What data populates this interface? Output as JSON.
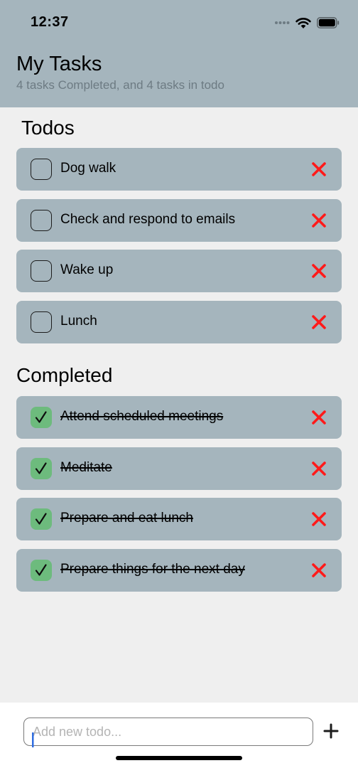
{
  "status_bar": {
    "time": "12:37"
  },
  "header": {
    "title": "My Tasks",
    "subtitle": "4 tasks Completed, and 4 tasks in todo"
  },
  "todos": {
    "section_title": "Todos",
    "items": [
      {
        "label": "Dog walk",
        "done": false
      },
      {
        "label": "Check and respond to emails",
        "done": false
      },
      {
        "label": "Wake up",
        "done": false
      },
      {
        "label": "Lunch",
        "done": false
      }
    ]
  },
  "completed": {
    "section_title": "Completed",
    "items": [
      {
        "label": "Attend scheduled meetings",
        "done": true
      },
      {
        "label": "Meditate",
        "done": true
      },
      {
        "label": "Prepare and eat lunch",
        "done": true
      },
      {
        "label": "Prepare things for the next day",
        "done": true
      }
    ]
  },
  "new_todo": {
    "placeholder": "Add new todo...",
    "value": ""
  },
  "colors": {
    "header_bg": "#a5b5bd",
    "row_bg": "#a5b5bd",
    "check_green": "#6dbb7d",
    "delete_red": "#ff1a1a",
    "page_bg": "#efefef"
  },
  "icons": {
    "checkbox_done": "checkmark-icon",
    "delete": "close-x-icon",
    "add": "plus-icon",
    "signal": "cellular-signal-icon",
    "wifi": "wifi-icon",
    "battery": "battery-icon"
  }
}
